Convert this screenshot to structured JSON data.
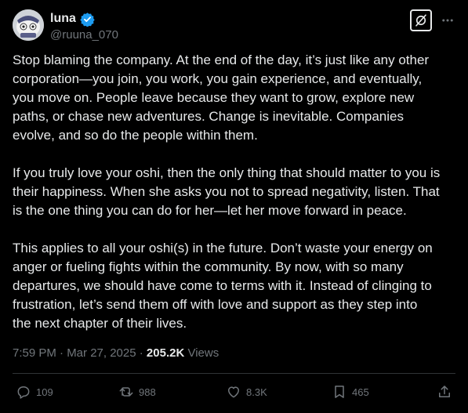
{
  "author": {
    "display_name": "luna",
    "handle": "@ruuna_070",
    "verified": true
  },
  "header_icons": [
    "grok-icon",
    "more-icon"
  ],
  "post": {
    "paragraphs": [
      "Stop blaming the company. At the end of the day, it’s just like any other\ncorporation—you join, you work, you gain experience, and eventually,\nyou move on. People leave because they want to grow, explore new\npaths, or chase new adventures. Change is inevitable. Companies\nevolve, and so do the people within them.",
      "If you truly love your oshi, then the only thing that should matter to you is\ntheir happiness. When she asks you not to spread negativity, listen. That\nis the one thing you can do for her—let her move forward in peace.",
      "This applies to all your oshi(s) in the future. Don’t waste your energy on\nanger or fueling fights within the community. By now, with so many\ndepartures, we should have come to terms with it. Instead of clinging to\nfrustration, let’s send them off with love and support as they step into\nthe next chapter of their lives."
    ],
    "timestamp": "7:59 PM · Mar 27, 2025 · ",
    "views_count": "205.2K",
    "views_label": " Views"
  },
  "actions": {
    "replies": "109",
    "reposts": "988",
    "likes": "8.3K",
    "bookmarks": "465"
  },
  "colors": {
    "background": "#000000",
    "text": "#e7e9ea",
    "muted": "#71767b",
    "verified": "#1d9bf0",
    "divider": "#2f3336"
  }
}
